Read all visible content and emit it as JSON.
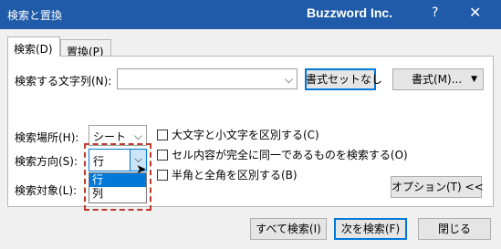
{
  "window": {
    "title": "検索と置換",
    "brand": "Buzzword Inc.",
    "help": "?",
    "close": "✕"
  },
  "tabs": [
    {
      "label": "検索(D)"
    },
    {
      "label": "置換(P)"
    }
  ],
  "find": {
    "label": "検索する文字列(N):",
    "value": "",
    "format_none_button": "書式セットなし",
    "format_button": "書式(M)..."
  },
  "options": {
    "within_label": "検索場所(H):",
    "within_value": "シート",
    "search_label": "検索方向(S):",
    "search_value": "行",
    "search_options": [
      "行",
      "列"
    ],
    "lookin_label": "検索対象(L):"
  },
  "checkboxes": [
    {
      "label": "大文字と小文字を区別する(C)",
      "checked": false
    },
    {
      "label": "セル内容が完全に同一であるものを検索する(O)",
      "checked": false
    },
    {
      "label": "半角と全角を区別する(B)",
      "checked": false
    }
  ],
  "buttons": {
    "options": "オプション(T) <<",
    "find_all": "すべて検索(I)",
    "find_next": "次を検索(F)",
    "close": "閉じる"
  }
}
